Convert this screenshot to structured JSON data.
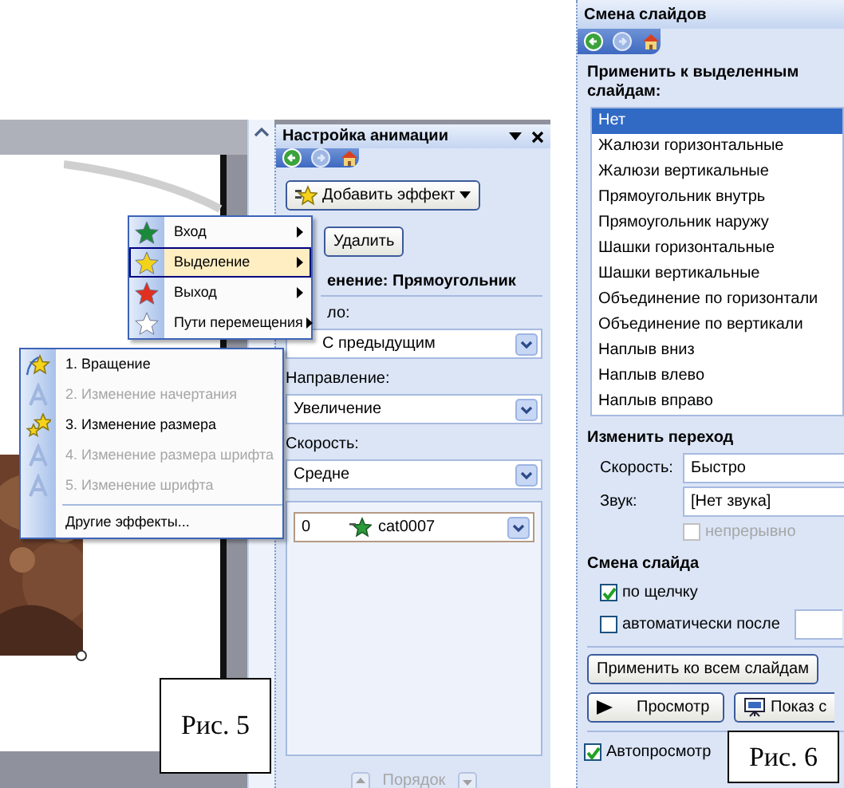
{
  "animation_figure": {
    "caption": "Рис. 5",
    "effect_menu": [
      {
        "label": "Вход",
        "color": "#1a8a3a",
        "selected": false
      },
      {
        "label": "Выделение",
        "color": "#f2d21c",
        "selected": true
      },
      {
        "label": "Выход",
        "color": "#e03020",
        "selected": false
      },
      {
        "label": "Пути перемещения",
        "color": "#ffffff",
        "selected": false
      }
    ],
    "emphasis_menu": [
      {
        "label": "1. Вращение",
        "kind": "star",
        "disabled": false
      },
      {
        "label": "2. Изменение начертания",
        "kind": "letter",
        "disabled": true
      },
      {
        "label": "3. Изменение размера",
        "kind": "stars",
        "disabled": false
      },
      {
        "label": "4. Изменение размера шрифта",
        "kind": "letter",
        "disabled": true
      },
      {
        "label": "5. Изменение шрифта",
        "kind": "letter",
        "disabled": true
      }
    ],
    "more_effects": "Другие эффекты...",
    "pane": {
      "title": "Настройка анимации",
      "add_effect_button": "Добавить эффект",
      "delete_button": "Удалить",
      "heading": "енение: Прямоугольник",
      "start_label": "ло:",
      "start_value": "С предыдущим",
      "direction_label": "Направление:",
      "direction_value": "Увеличение",
      "speed_label": "Скорость:",
      "speed_value": "Средне",
      "effects": [
        {
          "number": "0",
          "name": "cat0007"
        }
      ],
      "order_label": "Порядок"
    }
  },
  "transition_figure": {
    "caption": "Рис. 6",
    "pane": {
      "title": "Смена слайдов",
      "apply_label": "Применить к выделенным слайдам:",
      "transitions": [
        {
          "label": "Нет",
          "selected": true
        },
        {
          "label": "Жалюзи горизонтальные",
          "selected": false
        },
        {
          "label": "Жалюзи вертикальные",
          "selected": false
        },
        {
          "label": "Прямоугольник внутрь",
          "selected": false
        },
        {
          "label": "Прямоугольник наружу",
          "selected": false
        },
        {
          "label": "Шашки горизонтальные",
          "selected": false
        },
        {
          "label": "Шашки вертикальные",
          "selected": false
        },
        {
          "label": "Объединение по горизонтали",
          "selected": false
        },
        {
          "label": "Объединение по вертикали",
          "selected": false
        },
        {
          "label": "Наплыв вниз",
          "selected": false
        },
        {
          "label": "Наплыв влево",
          "selected": false
        },
        {
          "label": "Наплыв вправо",
          "selected": false
        }
      ],
      "modify_heading": "Изменить переход",
      "speed_label": "Скорость:",
      "speed_value": "Быстро",
      "sound_label": "Звук:",
      "sound_value": "[Нет звука]",
      "loop": {
        "label": "непрерывно",
        "checked": false,
        "disabled": true
      },
      "advance_heading": "Смена слайда",
      "on_click": {
        "label": "по щелчку",
        "checked": true
      },
      "automatic": {
        "label": "автоматически после",
        "checked": false
      },
      "apply_all_button": "Применить ко всем слайдам",
      "play_button": "Просмотр",
      "slideshow_button": "Показ с",
      "autopreview": {
        "label": "Автопросмотр",
        "checked": true
      }
    }
  }
}
